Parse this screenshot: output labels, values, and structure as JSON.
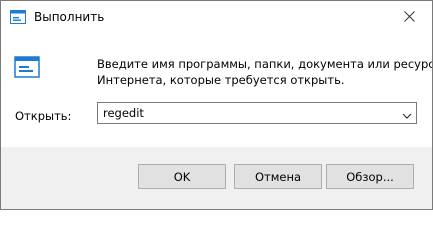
{
  "window": {
    "title": "Выполнить",
    "title_icon": "run-icon",
    "close_icon": "close-icon"
  },
  "main": {
    "icon": "run-icon",
    "description_line1": "Введите имя программы, папки, документа или ресурса",
    "description_line2": "Интернета, которые требуется открыть.",
    "open_label": "Открыть:",
    "open_value": "regedit",
    "dropdown_icon": "chevron-down-icon"
  },
  "buttons": {
    "ok": "OK",
    "cancel": "Отмена",
    "browse": "Обзор..."
  },
  "colors": {
    "accent": "#1e7bd2",
    "footer_bg": "#f0f0f0",
    "button_bg": "#e1e1e1",
    "border": "#7a7a7a"
  }
}
